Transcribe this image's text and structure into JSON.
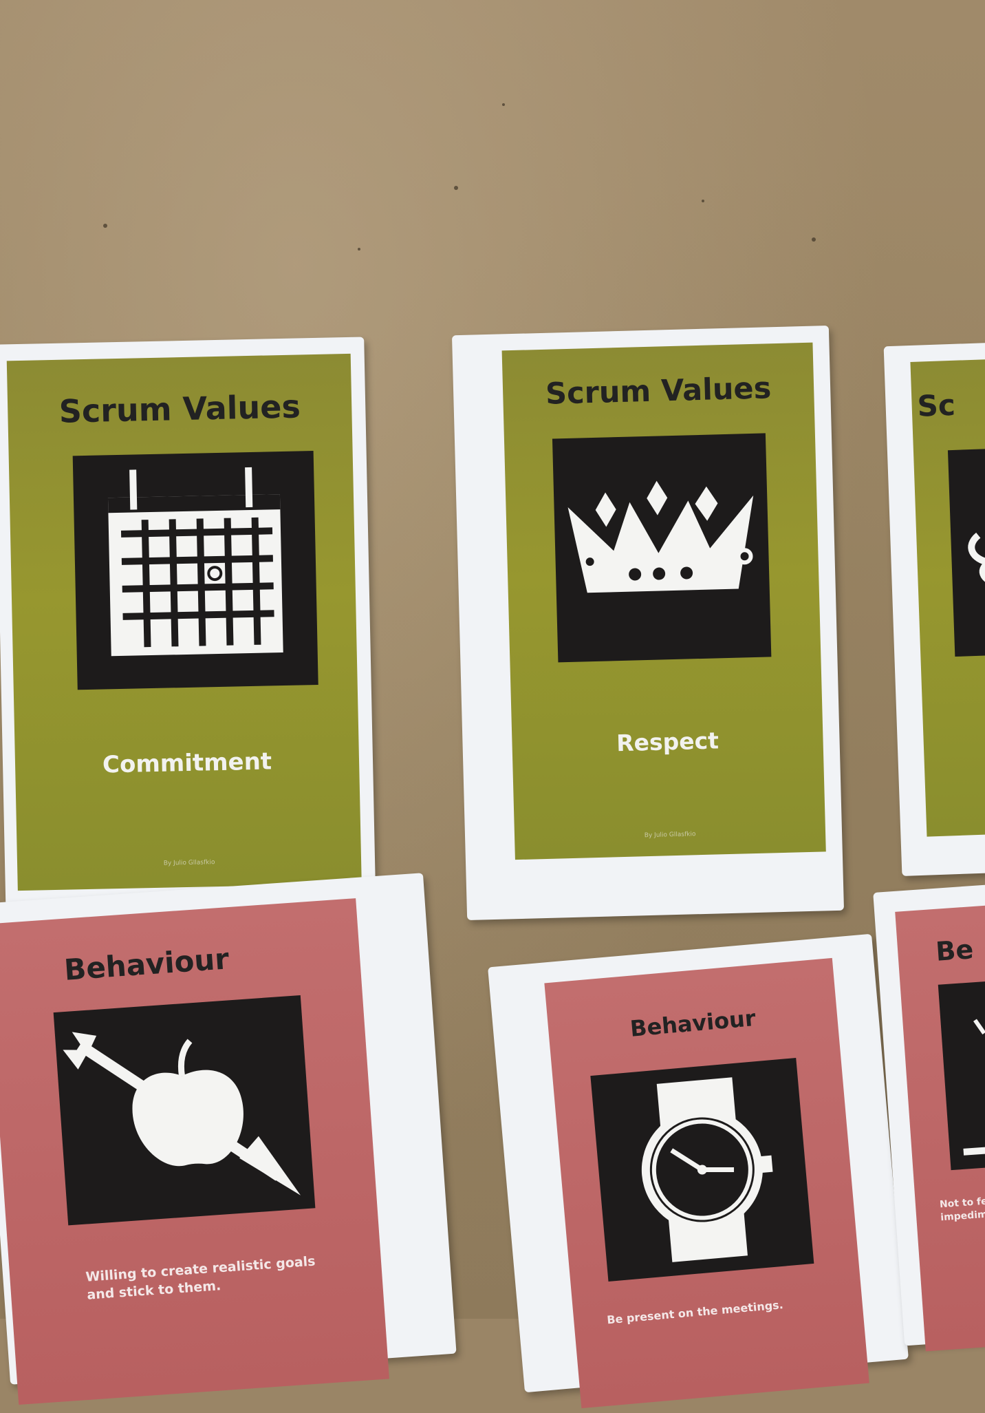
{
  "cards": {
    "commitment": {
      "title": "Scrum Values",
      "label": "Commitment",
      "icon": "calendar-icon",
      "byline": "By Julio Gllasfkio"
    },
    "respect": {
      "title": "Scrum Values",
      "label": "Respect",
      "icon": "crown-icon",
      "byline": "By Julio Gllasfkio"
    },
    "partial_top": {
      "title": "Sc",
      "icon": "steam-icon"
    },
    "behaviour_goals": {
      "title": "Behaviour",
      "icon": "apple-arrow-icon",
      "description_line1": "Willing to create realistic goals",
      "description_line2": "and stick to them."
    },
    "behaviour_meetings": {
      "title": "Behaviour",
      "icon": "watch-icon",
      "description": "Be present on the meetings."
    },
    "partial_bottom": {
      "title": "Be",
      "icon": "unknown-icon",
      "description_line1": "Not to fe",
      "description_line2": "impedim"
    }
  },
  "colors": {
    "board": "#9b8664",
    "value_card": "#8c8b33",
    "behaviour_card": "#b86060",
    "icon_bg": "#1d1b1b",
    "paper": "#f1f3f6"
  }
}
